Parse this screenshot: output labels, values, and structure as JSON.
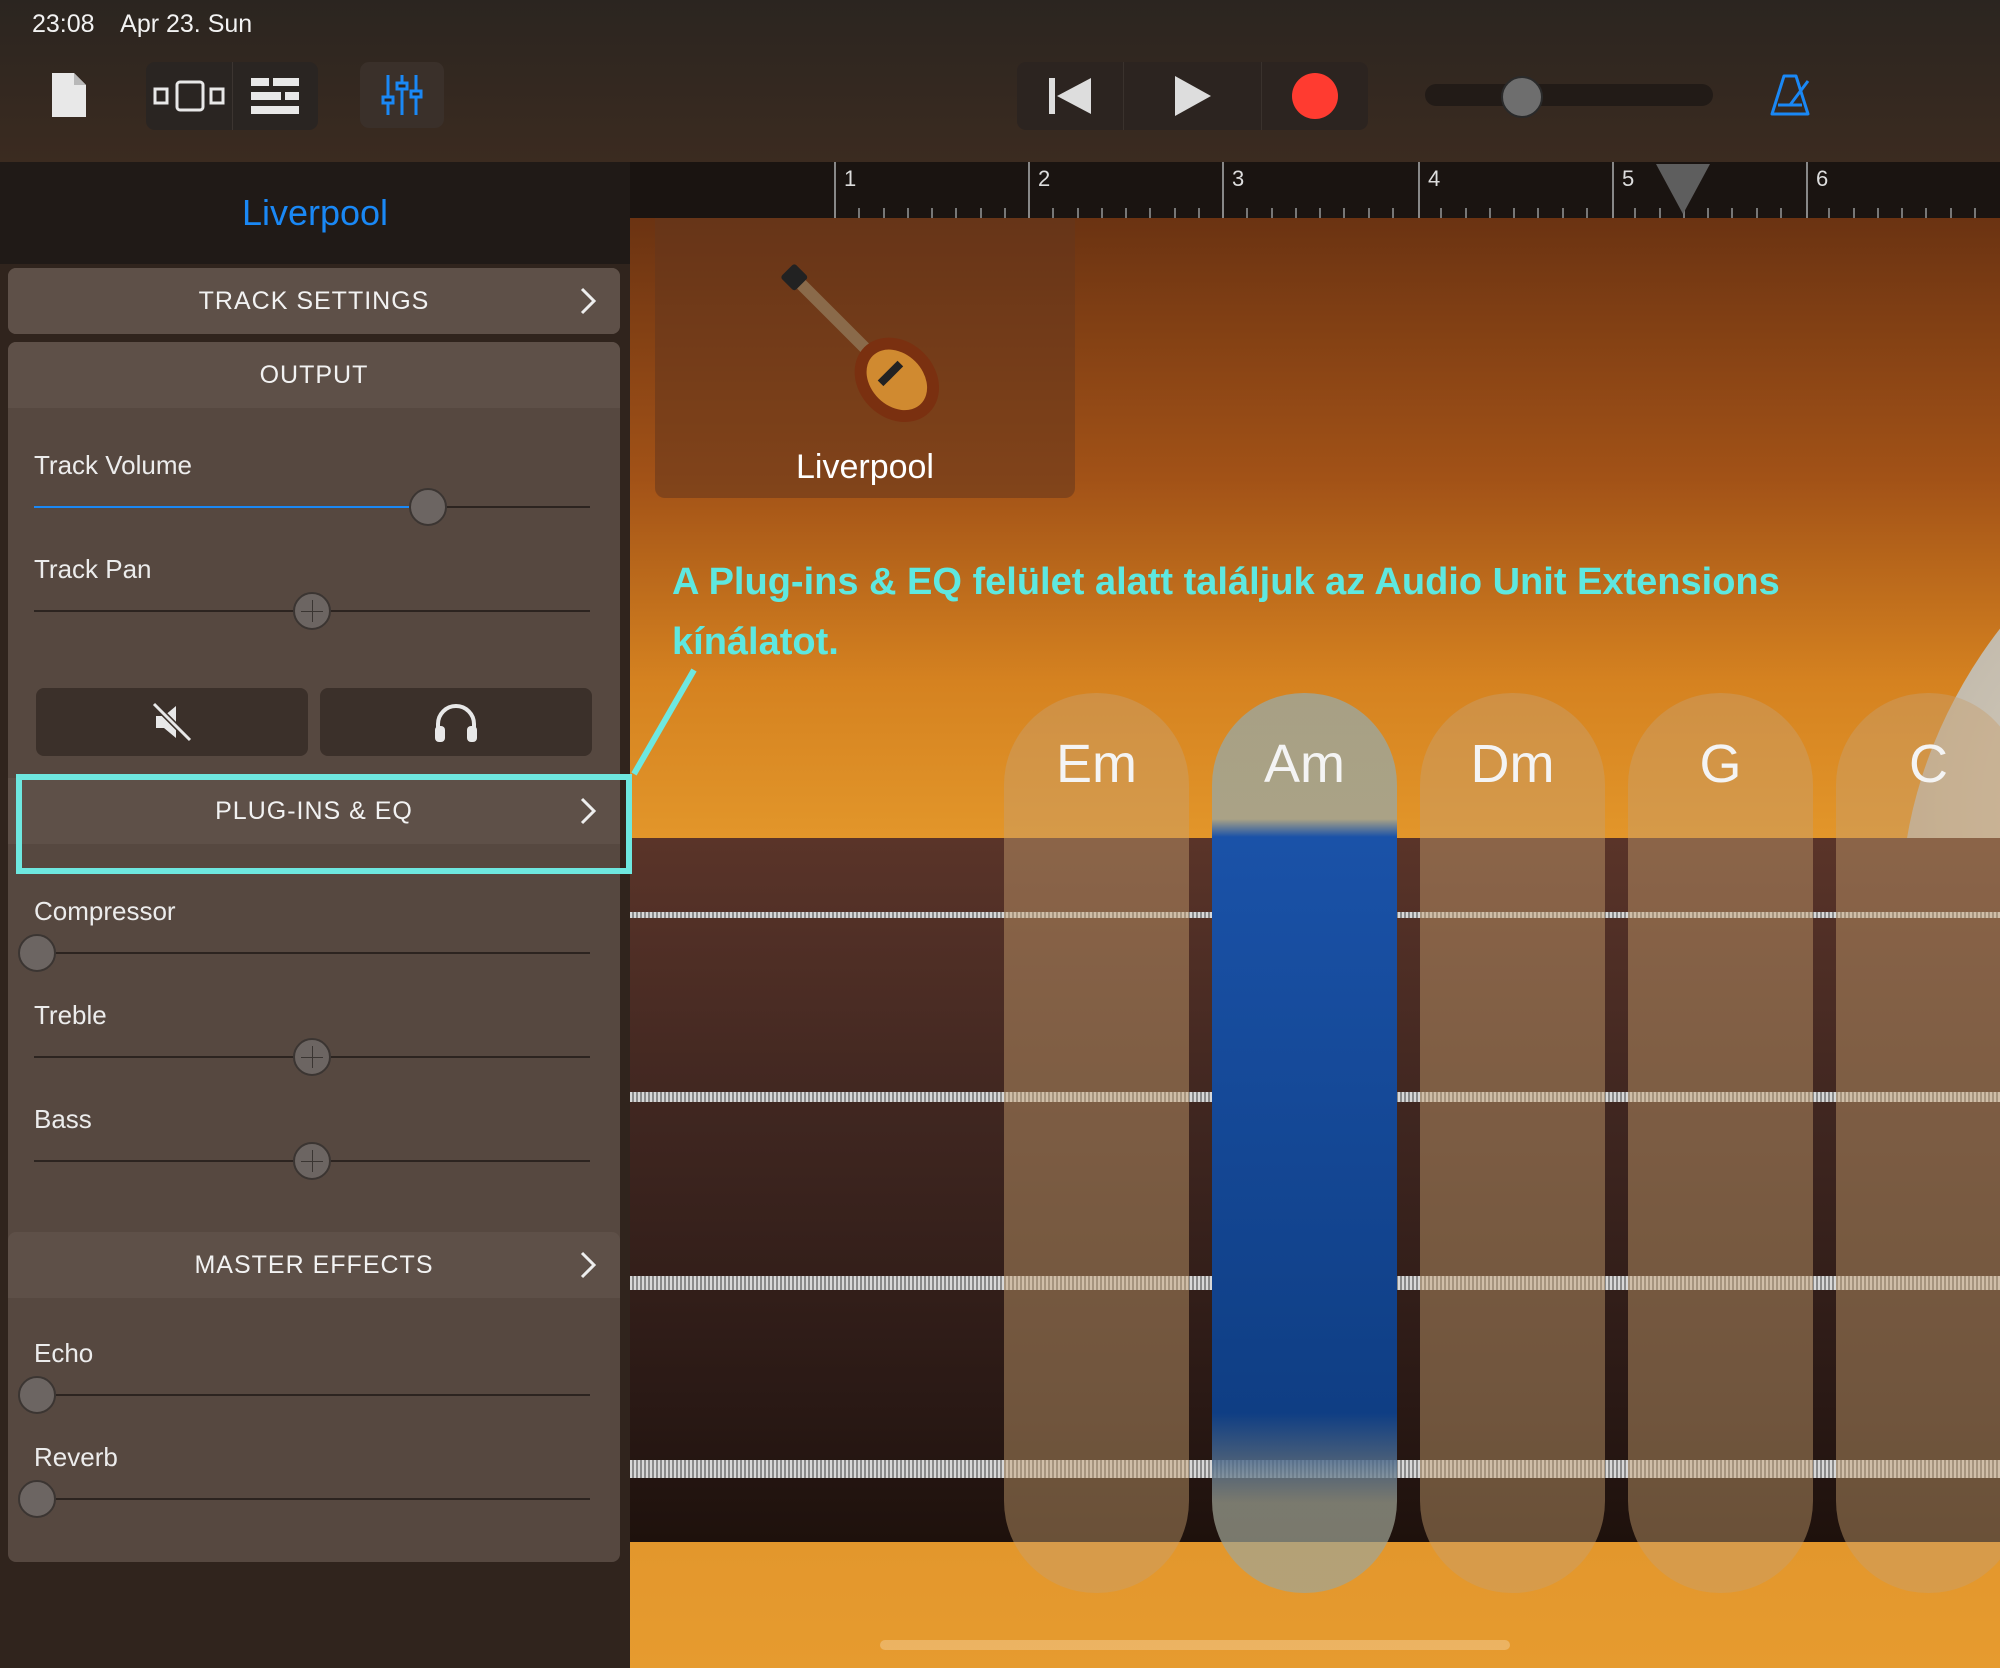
{
  "status": {
    "time": "23:08",
    "date": "Apr 23. Sun"
  },
  "toolbar": {
    "icons": [
      "document-icon",
      "view-switch-icon",
      "tracks-view-icon",
      "mixer-icon",
      "rewind-icon",
      "play-icon",
      "record-icon",
      "metronome-icon"
    ],
    "accent": "#1a88f5",
    "record_color": "#ff3b30"
  },
  "ruler": {
    "bars": [
      "1",
      "2",
      "3",
      "4",
      "5",
      "6"
    ]
  },
  "panel": {
    "title": "Liverpool",
    "track_settings": "TRACK SETTINGS",
    "output": {
      "header": "OUTPUT",
      "track_volume": {
        "label": "Track Volume",
        "value": 0.7
      },
      "track_pan": {
        "label": "Track Pan",
        "value": 0.5
      },
      "mute_icon": "speaker-muted-icon",
      "solo_icon": "headphones-icon"
    },
    "plugins": {
      "header": "PLUG-INS & EQ",
      "compressor": {
        "label": "Compressor",
        "value": 0.0
      },
      "treble": {
        "label": "Treble",
        "value": 0.5
      },
      "bass": {
        "label": "Bass",
        "value": 0.5
      }
    },
    "master": {
      "header": "MASTER EFFECTS",
      "echo": {
        "label": "Echo",
        "value": 0.0
      },
      "reverb": {
        "label": "Reverb",
        "value": 0.0
      }
    }
  },
  "instrument": {
    "name": "Liverpool",
    "icon": "bass-guitar-icon",
    "chords": [
      "Em",
      "Am",
      "Dm",
      "G",
      "C"
    ],
    "active_chord": "Am"
  },
  "annotation": {
    "text": "A Plug-ins & EQ felület alatt találjuk az Audio Unit Extensions kínálatot.",
    "color": "#5ee8e0"
  }
}
